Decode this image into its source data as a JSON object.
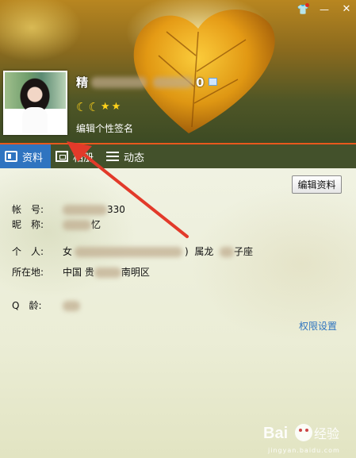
{
  "header": {
    "nickname_visible_start": "精",
    "nickname_visible_end": "0",
    "qq_badge_icon": "qq-show-icon",
    "signature_prompt": "编辑个性签名",
    "level_icons": [
      "moon-icon",
      "moon-icon",
      "star-icon",
      "star-icon"
    ],
    "window_controls": [
      "skin-icon",
      "minimize-icon",
      "close-icon"
    ]
  },
  "tabs": [
    {
      "label": "资料",
      "icon": "profile-card-icon",
      "active": true
    },
    {
      "label": "相册",
      "icon": "album-icon",
      "active": false
    },
    {
      "label": "动态",
      "icon": "feed-icon",
      "active": false
    }
  ],
  "profile": {
    "edit_button": "编辑资料",
    "account": {
      "label": "帐　号:",
      "value_tail": "330"
    },
    "nickname": {
      "label": "昵　称:",
      "value_tail": "忆"
    },
    "personal": {
      "label": "个　人:",
      "value_start": "女",
      "value_mid": ")",
      "zodiac": "属龙",
      "sign_tail": "子座"
    },
    "location": {
      "label": "所在地:",
      "value_start": "中国",
      "value_mid": "贵",
      "value_end": "南明区"
    },
    "qage": {
      "label": "Q　龄:",
      "value": ""
    },
    "permission_link": "权限设置"
  },
  "watermark": {
    "brand": "Bai",
    "brand2": "经验",
    "url": "jingyan.baidu.com"
  },
  "colors": {
    "tab_active": "#2f74c0",
    "accent_line": "#e8581d",
    "link": "#2f74c0",
    "arrow": "#e23a2a"
  }
}
